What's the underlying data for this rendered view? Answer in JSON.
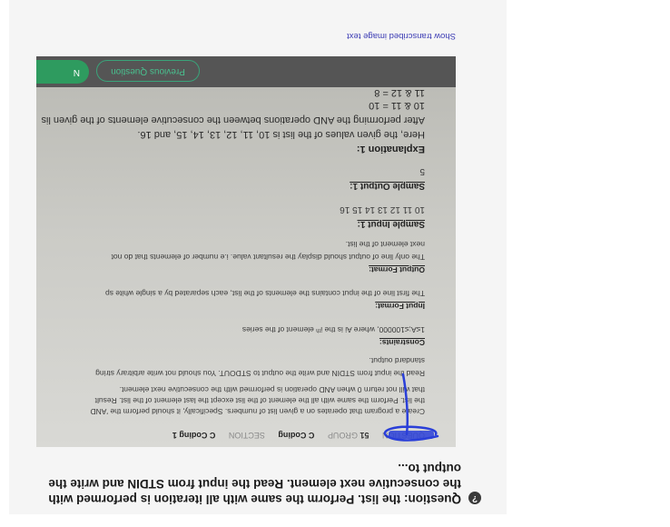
{
  "question": {
    "icon": "question-icon",
    "text": "Question: the list. Perform the same with all iteration is performed with the consecutive next element. Read the input from STDIN and write the output to..."
  },
  "photo": {
    "header": {
      "question_label": "QUESTION",
      "question_number": "51",
      "group_label": "GROUP",
      "group_value": "C Coding",
      "section_label": "SECTION",
      "section_value": "C Coding 1"
    },
    "lines": {
      "l1": "Create a program that operates on a given list of numbers. Specifically, it should perform the 'AND",
      "l2": "the list. Perform the same with all the element of the list except the last element of the list. Result",
      "l3": "that will not return 0 when AND operation is performed with the consecutive next element.",
      "l4": "Read the input from STDIN and write the output to STDOUT. You should not write arbitrary string",
      "l5": "standard output.",
      "constraints_h": "Constraints:",
      "constraints": "1≤A;≤100000, where Ai is the iᵗʰ element of the series",
      "input_h": "Input Format:",
      "input": "The first line of the input contains the elements of the list, each separated by a single white sp",
      "output_h": "Output Format:",
      "output1": "The only line of output should display the resultant value. i.e number of elements that do not",
      "output2": "next element of the list.",
      "sample_in_h": "Sample Input 1:",
      "sample_in": "10 11 12 13 14 15 16",
      "sample_out_h": "Sample Output 1:",
      "sample_out": "5",
      "expl_h": "Explanation 1:",
      "expl1": "Here, the given values of the list is 10, 11, 12, 13, 14, 15, and 16.",
      "expl2": "After performing the AND operations between the consecutive elements of the given lis",
      "calc1": "10 & 11 = 10",
      "calc2": "11 & 12 = 8"
    },
    "buttons": {
      "previous": "Previous Question",
      "next": "N"
    }
  },
  "show_transcribed": "Show transcribed image text",
  "colors": {
    "link": "#3c3cb4",
    "annotation": "#2a3fd8",
    "green": "#2e9b5f"
  }
}
